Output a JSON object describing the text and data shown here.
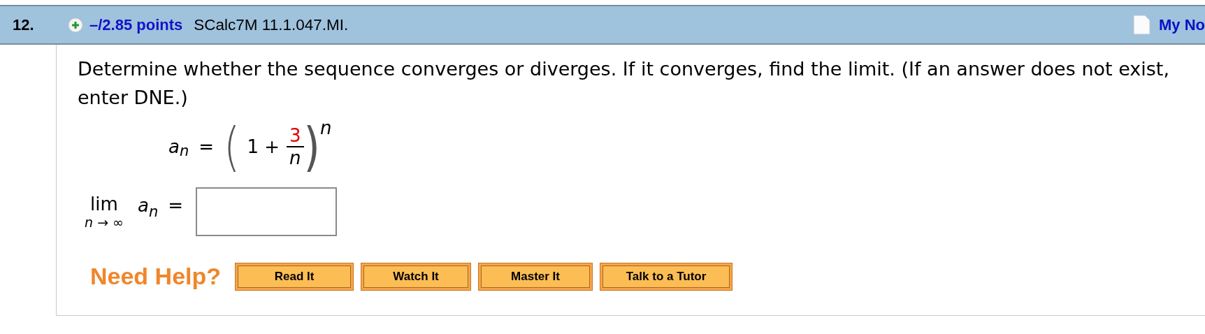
{
  "header": {
    "number": "12.",
    "points": "–/2.85 points",
    "source": "SCalc7M 11.1.047.MI.",
    "notes_link": "My No"
  },
  "question": {
    "text": "Determine whether the sequence converges or diverges. If it converges, find the limit. (If an answer does not exist, enter DNE.)",
    "formula": {
      "lhs": "a",
      "lhs_sub": "n",
      "equals": "=",
      "open_paren": "(",
      "one_plus": "1 +",
      "numerator": "3",
      "denominator": "n",
      "close_paren": ")",
      "exponent": "n"
    },
    "limit": {
      "lim": "lim",
      "under": "n → ∞",
      "expr": "a",
      "expr_sub": "n",
      "equals": "="
    }
  },
  "help": {
    "label": "Need Help?",
    "buttons": [
      "Read It",
      "Watch It",
      "Master It",
      "Talk to a Tutor"
    ]
  }
}
